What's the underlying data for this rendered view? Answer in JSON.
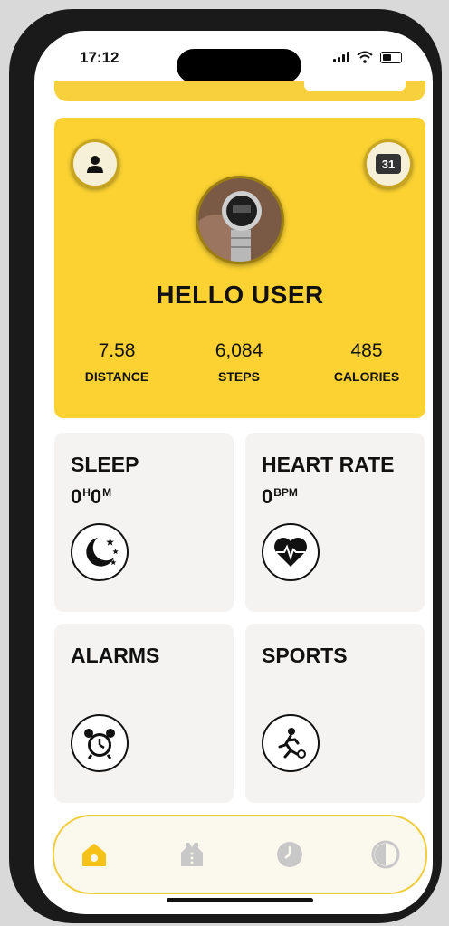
{
  "status_bar": {
    "time": "17:12"
  },
  "hero": {
    "greeting": "HELLO USER",
    "calendar_day": "31",
    "stats": [
      {
        "value": "7.58",
        "label": "DISTANCE"
      },
      {
        "value": "6,084",
        "label": "STEPS"
      },
      {
        "value": "485",
        "label": "CALORIES"
      }
    ]
  },
  "cards": {
    "sleep": {
      "title": "SLEEP",
      "hours": "0",
      "hours_unit": "H",
      "minutes": "0",
      "minutes_unit": "M"
    },
    "heart_rate": {
      "title": "HEART RATE",
      "value": "0",
      "unit": "BPM"
    },
    "alarms": {
      "title": "ALARMS"
    },
    "sports": {
      "title": "SPORTS"
    }
  },
  "tabs": [
    {
      "icon": "home-icon",
      "active": true
    },
    {
      "icon": "vest-icon",
      "active": false
    },
    {
      "icon": "clock-icon",
      "active": false
    },
    {
      "icon": "watch-face-icon",
      "active": false
    }
  ],
  "colors": {
    "accent": "#fbd232",
    "card_bg": "#f4f3f2",
    "tab_active": "#f6c21a",
    "tab_inactive": "#c8c8c8"
  }
}
